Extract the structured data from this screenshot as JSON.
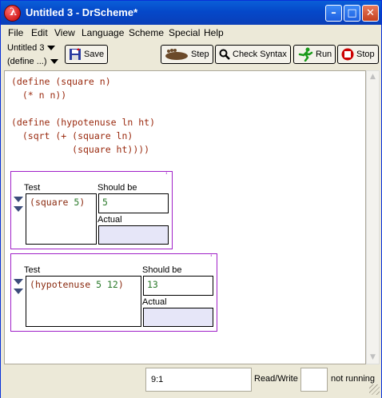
{
  "window": {
    "title": "Untitled 3 - DrScheme*"
  },
  "menu": [
    "File",
    "Edit",
    "View",
    "Language",
    "Scheme",
    "Special",
    "Help"
  ],
  "toolbar": {
    "file_nav": "Untitled 3",
    "define_nav": "(define ...)",
    "save_label": "Save",
    "step_label": "Step",
    "check_syntax_label": "Check Syntax",
    "run_label": "Run",
    "stop_label": "Stop"
  },
  "editor": {
    "code_lines": [
      "(define (square n)",
      "  (* n n))",
      "",
      "(define (hypotenuse ln ht)",
      "  (sqrt (+ (square ln)",
      "           (square ht))))"
    ],
    "test_boxes": [
      {
        "test_label": "Test",
        "should_be_label": "Should be",
        "actual_label": "Actual",
        "test_fn": "square",
        "test_arg": "5",
        "expected": "5",
        "actual": ""
      },
      {
        "test_label": "Test",
        "should_be_label": "Should be",
        "actual_label": "Actual",
        "test_fn": "hypotenuse",
        "test_arg": "5 12",
        "expected": "13",
        "actual": ""
      }
    ]
  },
  "status": {
    "position": "9:1",
    "mode": "Read/Write",
    "state": "not running"
  }
}
